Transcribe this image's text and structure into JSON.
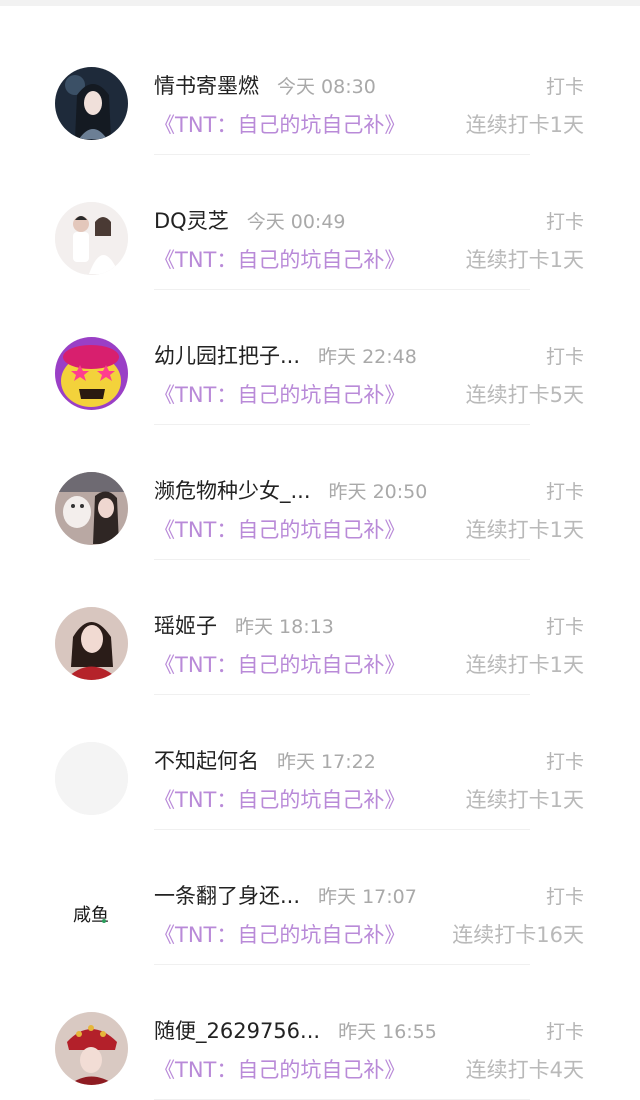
{
  "checkins": [
    {
      "name": "情书寄墨燃",
      "time": "今天 08:30",
      "action": "打卡",
      "book": "《TNT：自己的坑自己补》",
      "streak": "连续打卡1天",
      "avatar": "avatar-ancient-portrait"
    },
    {
      "name": "DQ灵芝",
      "time": "今天 00:49",
      "action": "打卡",
      "book": "《TNT：自己的坑自己补》",
      "streak": "连续打卡1天",
      "avatar": "avatar-couple-photo"
    },
    {
      "name": "幼儿园扛把子...",
      "time": "昨天 22:48",
      "action": "打卡",
      "book": "《TNT：自己的坑自己补》",
      "streak": "连续打卡5天",
      "avatar": "avatar-cartoon-purple"
    },
    {
      "name": "濒危物种少女_...",
      "time": "昨天 20:50",
      "action": "打卡",
      "book": "《TNT：自己的坑自己补》",
      "streak": "连续打卡1天",
      "avatar": "avatar-girl-with-cat"
    },
    {
      "name": "瑶姬子",
      "time": "昨天 18:13",
      "action": "打卡",
      "book": "《TNT：自己的坑自己补》",
      "streak": "连续打卡1天",
      "avatar": "avatar-girl-red-top"
    },
    {
      "name": "不知起何名",
      "time": "昨天 17:22",
      "action": "打卡",
      "book": "《TNT：自己的坑自己补》",
      "streak": "连续打卡1天",
      "avatar": "avatar-blank"
    },
    {
      "name": "一条翻了身还...",
      "time": "昨天 17:07",
      "action": "打卡",
      "book": "《TNT：自己的坑自己补》",
      "streak": "连续打卡16天",
      "avatar": "avatar-calligraphy-fish",
      "avatar_text": "咸鱼"
    },
    {
      "name": "随便_2629756...",
      "time": "昨天 16:55",
      "action": "打卡",
      "book": "《TNT：自己的坑自己补》",
      "streak": "连续打卡4天",
      "avatar": "avatar-opera-headdress"
    }
  ],
  "colors": {
    "book_title": "#b98ad8",
    "name": "#222222",
    "muted": "#a9a9a9"
  }
}
